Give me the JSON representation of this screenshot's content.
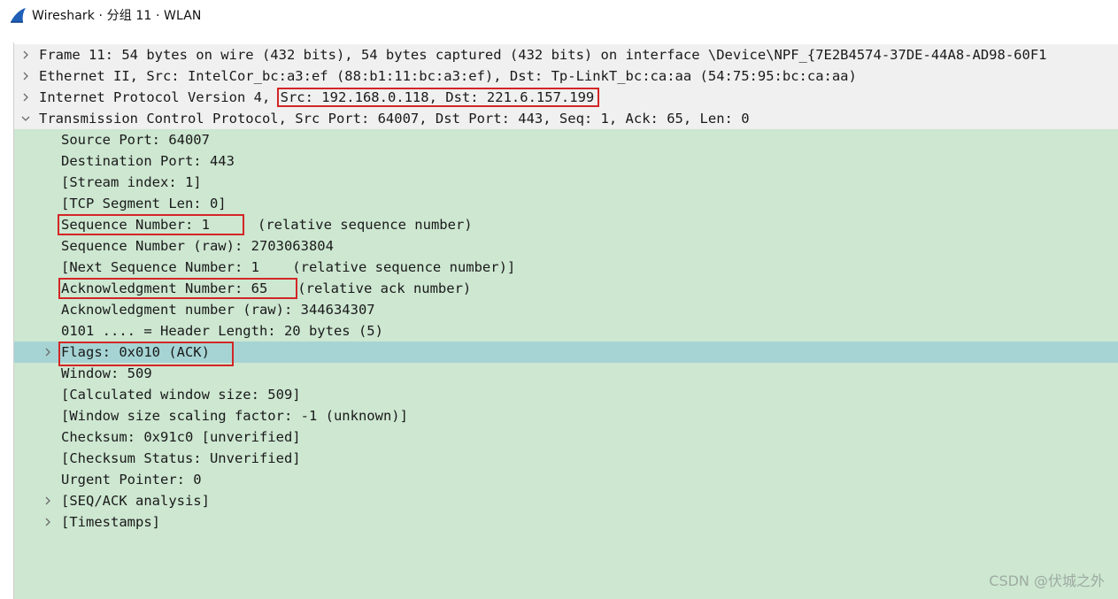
{
  "window": {
    "title": "Wireshark · 分组 11 · WLAN",
    "app_icon": "wireshark-fin-icon"
  },
  "tree": {
    "frame": "Frame 11: 54 bytes on wire (432 bits), 54 bytes captured (432 bits) on interface \\Device\\NPF_{7E2B4574-37DE-44A8-AD98-60F1",
    "ethernet": "Ethernet II, Src: IntelCor_bc:a3:ef (88:b1:11:bc:a3:ef), Dst: Tp-LinkT_bc:ca:aa (54:75:95:bc:ca:aa)",
    "ip_prefix": "Internet Protocol Version 4, ",
    "ip_addrs": "Src: 192.168.0.118, Dst: 221.6.157.199",
    "tcp": "Transmission Control Protocol, Src Port: 64007, Dst Port: 443, Seq: 1, Ack: 65, Len: 0",
    "tcp_fields": {
      "src_port": "Source Port: 64007",
      "dst_port": "Destination Port: 443",
      "stream_index": "[Stream index: 1]",
      "seg_len": "[TCP Segment Len: 0]",
      "seq_num": "Sequence Number: 1",
      "seq_note": "(relative sequence number)",
      "seq_raw": "Sequence Number (raw): 2703063804",
      "next_seq": "[Next Sequence Number: 1    (relative sequence number)]",
      "ack_num": "Acknowledgment Number: 65",
      "ack_note": "(relative ack number)",
      "ack_raw": "Acknowledgment number (raw): 344634307",
      "header_len": "0101 .... = Header Length: 20 bytes (5)",
      "flags": "Flags: 0x010 (ACK)",
      "window": "Window: 509",
      "calc_window": "[Calculated window size: 509]",
      "window_scale": "[Window size scaling factor: -1 (unknown)]",
      "checksum": "Checksum: 0x91c0 [unverified]",
      "checksum_status": "[Checksum Status: Unverified]",
      "urgent": "Urgent Pointer: 0",
      "seq_ack_analysis": "[SEQ/ACK analysis]",
      "timestamps": "[Timestamps]"
    }
  },
  "watermark": "CSDN @伏城之外",
  "colors": {
    "child_bg": "#cde7d1",
    "selected_bg": "#a6d4d4",
    "top_bg": "#f0f0f0",
    "highlight_border": "#d32626"
  }
}
